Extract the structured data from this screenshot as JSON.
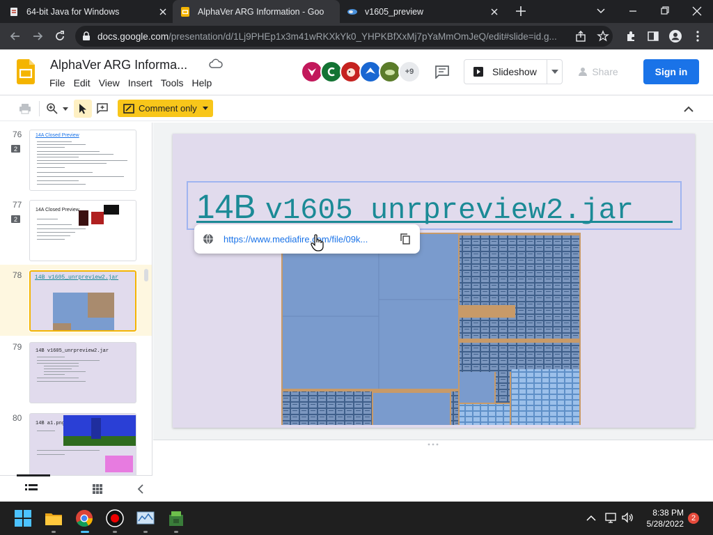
{
  "browser": {
    "tabs": [
      {
        "title": "64-bit Java for Windows",
        "active": false
      },
      {
        "title": "AlphaVer ARG Information - Goo",
        "active": true
      },
      {
        "title": "v1605_preview",
        "active": false
      }
    ],
    "url_host": "docs.google.com",
    "url_path": "/presentation/d/1Lj9PHEp1x3m41wRKXkYk0_YHPKBfXxMj7pYaMmOmJeQ/edit#slide=id.g..."
  },
  "docs": {
    "title": "AlphaVer ARG Informa...",
    "menu": [
      "File",
      "Edit",
      "View",
      "Insert",
      "Tools",
      "Help"
    ],
    "collaborators_extra": "+9",
    "slideshow_label": "Slideshow",
    "share_label": "Share",
    "signin_label": "Sign in",
    "comment_only_label": "Comment only"
  },
  "filmstrip": {
    "slides": [
      {
        "number": "76",
        "title": "14A Closed Preview",
        "comments": "2"
      },
      {
        "number": "77",
        "title": "14A Closed Preview",
        "comments": "2"
      },
      {
        "number": "78",
        "title": "14B v1605_unrpreview2.jar",
        "comments": ""
      },
      {
        "number": "79",
        "title": "14B v1605_unrpreview2.jar",
        "comments": ""
      },
      {
        "number": "80",
        "title": "14B a1.png",
        "comments": ""
      }
    ]
  },
  "slide": {
    "title_prefix": "14B",
    "title_mono": "v1605 unrpreview2.jar",
    "link_url": "https://www.mediafire.com/file/09k..."
  },
  "taskbar": {
    "time": "8:38 PM",
    "date": "5/28/2022",
    "notifications": "2"
  },
  "colors": {
    "accent": "#1a73e8",
    "comment_badge": "#f8c61a",
    "slide_bg": "#e1dbed",
    "title_teal": "#1b8a96"
  }
}
